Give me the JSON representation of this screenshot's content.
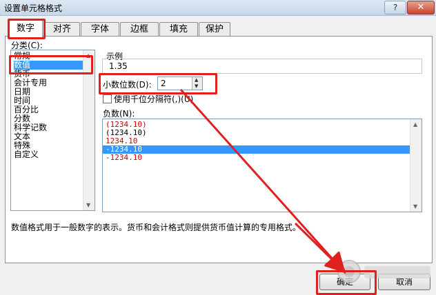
{
  "window": {
    "title": "设置单元格格式",
    "help_label": "?",
    "close_label": "✕"
  },
  "tabs": [
    {
      "label": "数字"
    },
    {
      "label": "对齐"
    },
    {
      "label": "字体"
    },
    {
      "label": "边框"
    },
    {
      "label": "填充"
    },
    {
      "label": "保护"
    }
  ],
  "category": {
    "label": "分类(C):",
    "items": [
      "常规",
      "数值",
      "货币",
      "会计专用",
      "日期",
      "时间",
      "百分比",
      "分数",
      "科学记数",
      "文本",
      "特殊",
      "自定义"
    ],
    "selected": "数值"
  },
  "sample": {
    "label": "示例",
    "value": "1.35"
  },
  "decimal": {
    "label": "小数位数(D):",
    "value": "2"
  },
  "thousands": {
    "label": "使用千位分隔符(,)(U)",
    "checked": false
  },
  "negative": {
    "label": "负数(N):",
    "items": [
      {
        "text": "(1234.10)",
        "color": "#cc0000"
      },
      {
        "text": "(1234.10)",
        "color": "#000000"
      },
      {
        "text": "1234.10",
        "color": "#cc0000"
      },
      {
        "text": "-1234.10",
        "color": "#ffffff",
        "selected": true
      },
      {
        "text": "-1234.10",
        "color": "#cc0000"
      }
    ]
  },
  "description": "数值格式用于一般数字的表示。货币和会计格式则提供货币值计算的专用格式。",
  "buttons": {
    "ok": "确定",
    "cancel": "取消"
  },
  "colors": {
    "annotation": "#e0201e",
    "selection": "#3399ff"
  }
}
